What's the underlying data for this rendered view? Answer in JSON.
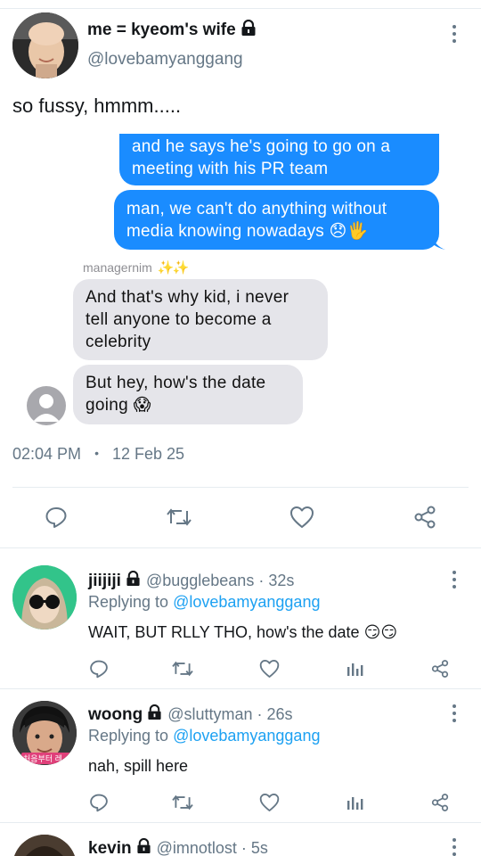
{
  "main_tweet": {
    "display_name": "me = kyeom's wife",
    "handle": "@lovebamyanggang",
    "text": "so fussy, hmmm.....",
    "chat": {
      "sent_1": "and he says he's going to go on a meeting with his PR team",
      "sent_1_line1": "and he says he's going to go on a",
      "sent_1_line2": "meeting with his PR team",
      "sent_2_line1": "man, we can't do anything without",
      "sent_2_line2": "media knowing nowadays",
      "sent_2_emoji": "😞🖐",
      "sender_name": "managernim",
      "sender_emoji": "✨✨",
      "recv_1_line1": "And that's why kid, i never",
      "recv_1_line2": "tell anyone to become a",
      "recv_1_line3": "celebrity",
      "recv_2_line1": "But hey, how's the date",
      "recv_2_line2": "going",
      "recv_2_emoji": "😱"
    },
    "time": "02:04 PM",
    "separator": "•",
    "date": "12 Feb 25"
  },
  "replies": [
    {
      "display_name": "jiijiji",
      "handle": "@bugglebeans",
      "age": "· 32s",
      "replying_prefix": "Replying to",
      "replying_to": "@lovebamyanggang",
      "text": "WAIT, BUT RLLY THO, how's the date",
      "emoji": "😏😏"
    },
    {
      "display_name": "woong",
      "handle": "@sluttyman",
      "age": "· 26s",
      "replying_prefix": "Replying to",
      "replying_to": "@lovebamyanggang",
      "text": "nah, spill here",
      "avatar_caption": "처음부터 레…"
    },
    {
      "display_name": "kevin",
      "handle": "@imnotlost",
      "age": "· 5s"
    }
  ],
  "colors": {
    "blue_bubble": "#1a8cff",
    "gray_bubble": "#e5e5ea",
    "link": "#1da1f2",
    "secondary_text": "#657786"
  },
  "icons": [
    "lock-icon",
    "more-icon",
    "reply-icon",
    "retweet-icon",
    "like-icon",
    "share-icon",
    "analytics-icon"
  ]
}
